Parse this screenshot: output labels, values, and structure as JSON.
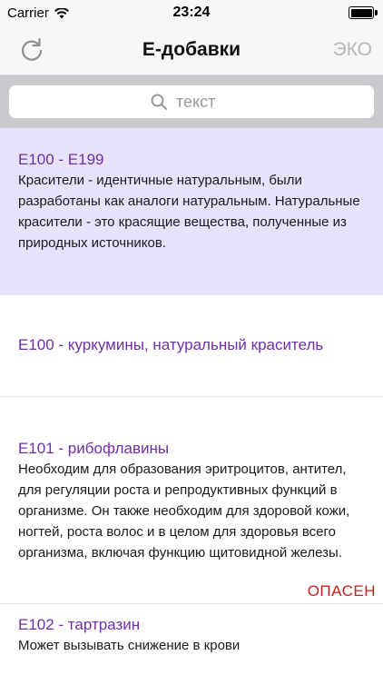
{
  "status_bar": {
    "carrier": "Carrier",
    "time": "23:24"
  },
  "nav": {
    "title": "E-добавки",
    "right_label": "ЭКО"
  },
  "search": {
    "placeholder": "текст"
  },
  "list": [
    {
      "title": "E100 - E199",
      "description": "Красители - идентичные натуральным, были разработаны как аналоги натуральным. Натуральные красители - это красящие вещества, полученные из природных источников.",
      "badge": ""
    },
    {
      "title": "E100 - куркумины, натуральный краситель",
      "description": "",
      "badge": ""
    },
    {
      "title": "E101 - рибофлавины",
      "description": "Необходим для образования эритроцитов, антител, для регуляции роста и репродуктивных функций в организме. Он также необходим для здоровой кожи, ногтей, роста волос и в целом для здоровья всего организма, включая функцию щитовидной железы.",
      "badge": "ОПАСЕН"
    },
    {
      "title": "E102 - тартразин",
      "description": "Может вызывать снижение в крови",
      "badge": ""
    }
  ],
  "colors": {
    "accent_title": "#6f2fa8",
    "highlight_bg": "#e7e2fb",
    "danger": "#c81e1e"
  }
}
